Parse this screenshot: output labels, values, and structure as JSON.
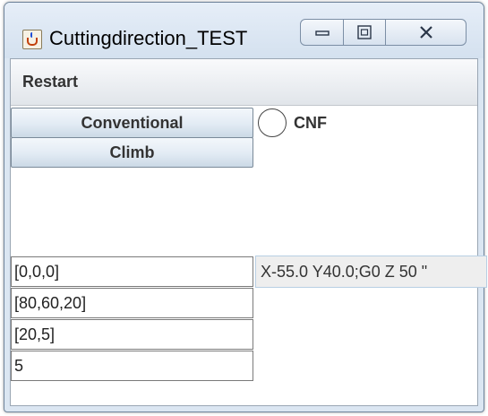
{
  "window": {
    "title": "Cuttingdirection_TEST",
    "controls": {
      "minimize_icon": "minimize-icon",
      "maximize_icon": "maximize-icon",
      "close_icon": "close-icon"
    },
    "app_icon": "java-cup-icon"
  },
  "menubar": {
    "items": [
      {
        "label": "Restart"
      }
    ]
  },
  "buttons": {
    "conventional_label": "Conventional",
    "climb_label": "Climb"
  },
  "radio": {
    "label": "CNF",
    "selected": false
  },
  "fields": [
    {
      "value": "[0,0,0]"
    },
    {
      "value": "[80,60,20]"
    },
    {
      "value": "[20,5]"
    },
    {
      "value": "5"
    }
  ],
  "output": {
    "text": "X-55.0 Y40.0;G0 Z 50 \""
  },
  "colors": {
    "titlebar": "#d4e1ef",
    "button_face": "#e2ebf4",
    "panel": "#ffffff",
    "output_border": "#b8cfe4"
  }
}
